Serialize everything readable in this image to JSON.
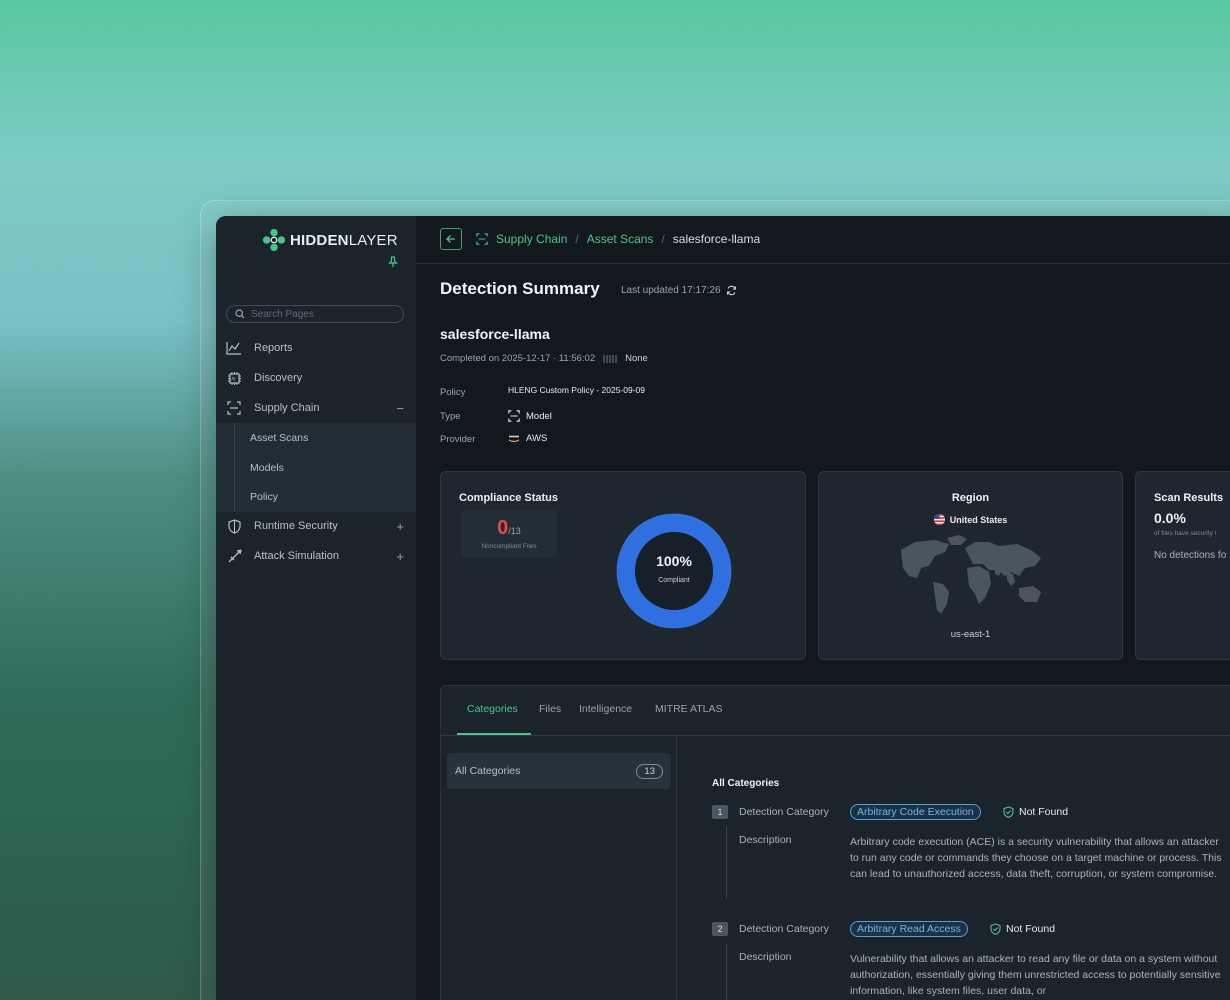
{
  "sidebar": {
    "logo_text_bold": "HIDDEN",
    "logo_text_rest": "LAYER",
    "search_placeholder": "Search Pages",
    "items": [
      {
        "label": "Reports",
        "icon": "chart-line-icon"
      },
      {
        "label": "Discovery",
        "icon": "chip-icon"
      },
      {
        "label": "Supply Chain",
        "icon": "scan-frame-icon",
        "trail": "−"
      },
      {
        "label": "Runtime Security",
        "icon": "shield-icon",
        "trail": "+"
      },
      {
        "label": "Attack Simulation",
        "icon": "sword-icon",
        "trail": "+"
      }
    ],
    "sub_items": [
      "Asset Scans",
      "Models",
      "Policy"
    ]
  },
  "breadcrumb": {
    "items": [
      "Supply Chain",
      "Asset Scans"
    ],
    "current": "salesforce-llama",
    "separator": "/"
  },
  "header": {
    "title": "Detection Summary",
    "updated": "Last updated 17:17:26"
  },
  "asset": {
    "name": "salesforce-llama",
    "completed": "Completed on 2025-12-17 · 11:56:02",
    "severity": "None",
    "policy_label": "Policy",
    "policy_value": "HLENG Custom Policy - 2025-09-09",
    "type_label": "Type",
    "type_value": "Model",
    "provider_label": "Provider",
    "provider_value": "AWS"
  },
  "compliance": {
    "title": "Compliance Status",
    "noncompliant": "0",
    "total": "/13",
    "noncompliant_label": "Noncompliant Files",
    "percent": "100%",
    "percent_label": "Compliant",
    "compliant_fraction": 1.0
  },
  "region": {
    "title": "Region",
    "country": "United States",
    "zone": "us-east-1"
  },
  "scan_results": {
    "title": "Scan Results",
    "value": "0.0%",
    "subtitle": "of files have security i",
    "message": "No detections fo"
  },
  "tabs": {
    "items": [
      "Categories",
      "Files",
      "Intelligence",
      "MITRE ATLAS"
    ],
    "active": "Categories"
  },
  "categories": {
    "all_label": "All Categories",
    "all_count": "13",
    "heading": "All Categories",
    "detection_label": "Detection Category",
    "description_label": "Description",
    "items": [
      {
        "num": "1",
        "name": "Arbitrary Code Execution",
        "status": "Not Found",
        "desc": "Arbitrary code execution (ACE) is a security vulnerability that allows an attacker to run any code or commands they choose on a target machine or process. This can lead to unauthorized access, data theft, corruption, or system compromise."
      },
      {
        "num": "2",
        "name": "Arbitrary Read Access",
        "status": "Not Found",
        "desc": "Vulnerability that allows an attacker to read any file or data on a system without authorization, essentially giving them unrestricted access to potentially sensitive information, like system files, user data, or"
      }
    ]
  },
  "colors": {
    "accent": "#4cc38a",
    "danger": "#e5484d",
    "chip": "#4aa3e6",
    "donut": "#2f6fe0"
  }
}
